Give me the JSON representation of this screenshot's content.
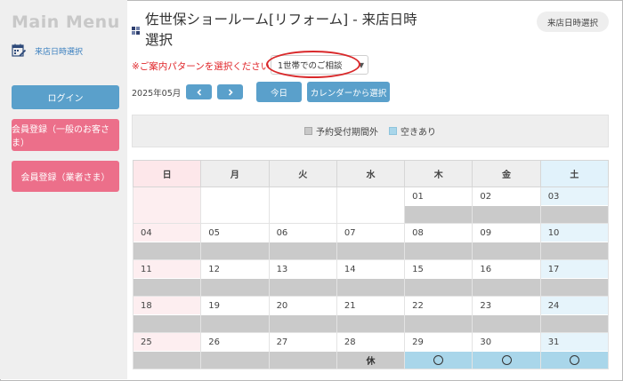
{
  "sidebar": {
    "title": "Main Menu",
    "link_label": "来店日時選択",
    "login_label": "ログイン",
    "member_label": "会員登録（一般のお客さま）",
    "biz_label": "会員登録（業者さま）"
  },
  "header": {
    "title": "佐世保ショールーム[リフォーム] - 来店日時選択",
    "chip_label": "来店日時選択"
  },
  "pattern": {
    "prompt": "※ご案内パターンを選択ください",
    "selected": "1世帯でのご相談"
  },
  "nav": {
    "month": "2025年05月",
    "today_label": "今日",
    "calendar_select_label": "カレンダーから選択"
  },
  "legend": {
    "unavailable": "予約受付期間外",
    "available": "空きあり"
  },
  "calendar": {
    "weekdays": [
      "日",
      "月",
      "火",
      "水",
      "木",
      "金",
      "土"
    ],
    "weeks": [
      [
        {
          "d": ""
        },
        {
          "d": ""
        },
        {
          "d": ""
        },
        {
          "d": ""
        },
        {
          "d": "01",
          "s": "out"
        },
        {
          "d": "02",
          "s": "out"
        },
        {
          "d": "03",
          "s": "out"
        }
      ],
      [
        {
          "d": "04",
          "s": "out"
        },
        {
          "d": "05",
          "s": "out"
        },
        {
          "d": "06",
          "s": "out"
        },
        {
          "d": "07",
          "s": "out"
        },
        {
          "d": "08",
          "s": "out"
        },
        {
          "d": "09",
          "s": "out"
        },
        {
          "d": "10",
          "s": "out"
        }
      ],
      [
        {
          "d": "11",
          "s": "out"
        },
        {
          "d": "12",
          "s": "out"
        },
        {
          "d": "13",
          "s": "out"
        },
        {
          "d": "14",
          "s": "out"
        },
        {
          "d": "15",
          "s": "out"
        },
        {
          "d": "16",
          "s": "out"
        },
        {
          "d": "17",
          "s": "out"
        }
      ],
      [
        {
          "d": "18",
          "s": "out"
        },
        {
          "d": "19",
          "s": "out"
        },
        {
          "d": "20",
          "s": "out"
        },
        {
          "d": "21",
          "s": "out"
        },
        {
          "d": "22",
          "s": "out"
        },
        {
          "d": "23",
          "s": "out"
        },
        {
          "d": "24",
          "s": "out"
        }
      ],
      [
        {
          "d": "25",
          "s": "out"
        },
        {
          "d": "26",
          "s": "out"
        },
        {
          "d": "27",
          "s": "out"
        },
        {
          "d": "28",
          "s": "closed",
          "label": "休"
        },
        {
          "d": "29",
          "s": "avail"
        },
        {
          "d": "30",
          "s": "avail"
        },
        {
          "d": "31",
          "s": "avail"
        }
      ]
    ]
  },
  "colors": {
    "accent": "#5aa0cb",
    "member": "#ec6f8a",
    "available": "#a9d6ea",
    "unavailable": "#cacaca",
    "prompt": "#e0262a"
  },
  "icons": {
    "sidebar_link": "calendar-edit-icon",
    "title": "grid-icon",
    "prev": "chevron-left-icon",
    "next": "chevron-right-icon",
    "select": "caret-down-icon",
    "available_mark": "circle-icon"
  }
}
